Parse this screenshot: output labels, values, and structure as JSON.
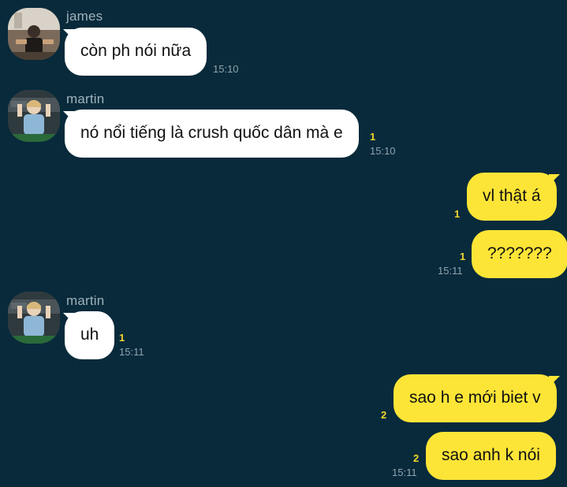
{
  "messages": [
    {
      "sender": "james",
      "text": "còn ph nói nữa",
      "time": "15:10"
    },
    {
      "sender": "martin",
      "text": "nó nổi tiếng là crush quốc dân mà e",
      "unread": "1",
      "time": "15:10"
    },
    {
      "text": "vl thật á",
      "unread": "1"
    },
    {
      "text": "???????",
      "unread": "1",
      "time": "15:11"
    },
    {
      "sender": "martin",
      "text": "uh",
      "unread": "1",
      "time": "15:11"
    },
    {
      "text": "sao h e mới biet v",
      "unread": "2"
    },
    {
      "text": "sao anh k nói",
      "unread": "2",
      "time": "15:11"
    }
  ],
  "colors": {
    "background": "#082a3b",
    "incoming_bubble": "#ffffff",
    "outgoing_bubble": "#fde537",
    "unread_count": "#f2d72b"
  },
  "icons": {
    "avatar_james": "profile-photo",
    "avatar_martin": "profile-photo"
  }
}
